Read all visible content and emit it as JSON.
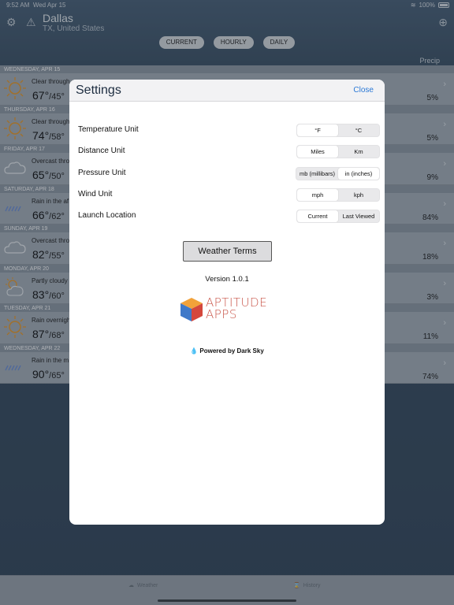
{
  "status": {
    "time": "9:52 AM",
    "date": "Wed Apr 15",
    "battery": "100%"
  },
  "location": {
    "city": "Dallas",
    "region": "TX, United States"
  },
  "view_tabs": [
    "CURRENT",
    "HOURLY",
    "DAILY"
  ],
  "precip_header": "Precip",
  "days": [
    {
      "day": "WEDNESDAY, APR 15",
      "desc": "Clear through",
      "hi": "67°",
      "lo": "/45°",
      "precip": "5%",
      "icon": "sun-icon"
    },
    {
      "day": "THURSDAY, APR 16",
      "desc": "Clear through",
      "hi": "74°",
      "lo": "/58°",
      "precip": "5%",
      "icon": "sun-icon"
    },
    {
      "day": "FRIDAY, APR 17",
      "desc": "Overcast thro",
      "hi": "65°",
      "lo": "/50°",
      "precip": "9%",
      "icon": "cloud-icon"
    },
    {
      "day": "SATURDAY, APR 18",
      "desc": "Rain in the af",
      "hi": "66°",
      "lo": "/62°",
      "precip": "84%",
      "icon": "rain-icon"
    },
    {
      "day": "SUNDAY, APR 19",
      "desc": "Overcast thro",
      "hi": "82°",
      "lo": "/55°",
      "precip": "18%",
      "icon": "cloud-icon"
    },
    {
      "day": "MONDAY, APR 20",
      "desc": "Partly cloudy",
      "hi": "83°",
      "lo": "/60°",
      "precip": "3%",
      "icon": "partly-cloudy-icon"
    },
    {
      "day": "TUESDAY, APR 21",
      "desc": "Rain overnigh",
      "hi": "87°",
      "lo": "/68°",
      "precip": "11%",
      "icon": "sun-icon"
    },
    {
      "day": "WEDNESDAY, APR 22",
      "desc": "Rain in the m",
      "hi": "90°",
      "lo": "/65°",
      "precip": "74%",
      "icon": "rain-icon"
    }
  ],
  "bottom_tabs": {
    "weather": "Weather",
    "history": "History"
  },
  "settings": {
    "title": "Settings",
    "close": "Close",
    "rows": [
      {
        "label": "Temperature Unit",
        "options": [
          "°F",
          "°C"
        ],
        "selected": 0
      },
      {
        "label": "Distance Unit",
        "options": [
          "Miles",
          "Km"
        ],
        "selected": 0
      },
      {
        "label": "Pressure Unit",
        "options": [
          "mb (millibars)",
          "in (inches)"
        ],
        "selected": 1
      },
      {
        "label": "Wind Unit",
        "options": [
          "mph",
          "kph"
        ],
        "selected": 0
      },
      {
        "label": "Launch Location",
        "options": [
          "Current",
          "Last Viewed"
        ],
        "selected": 0
      }
    ],
    "weather_terms": "Weather Terms",
    "version": "Version 1.0.1",
    "logo_line1": "APTITUDE",
    "logo_line2": "APPS",
    "powered_by": "Powered by Dark Sky"
  },
  "colors": {
    "accent": "#2a78d6",
    "logo": "#c9564a"
  }
}
